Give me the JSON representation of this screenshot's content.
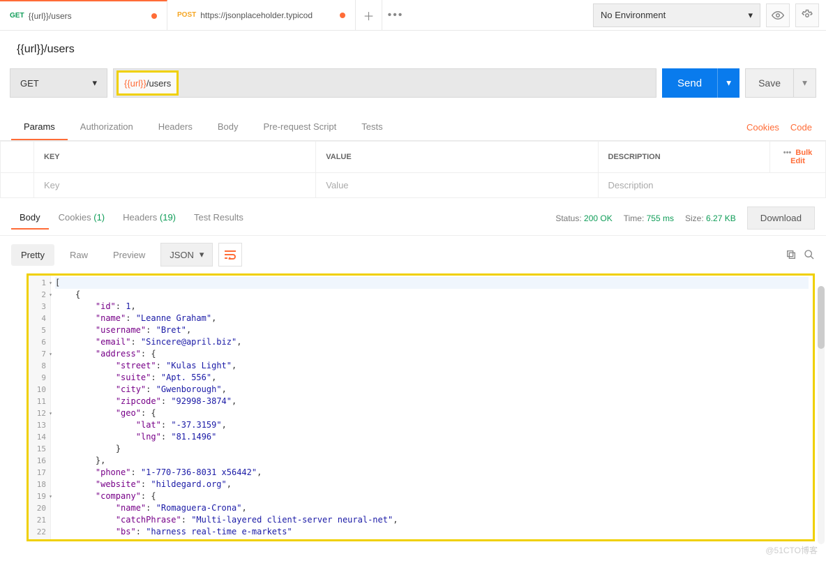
{
  "top": {
    "tabs": [
      {
        "method": "GET",
        "title": "{{url}}/users",
        "dirty": true
      },
      {
        "method": "POST",
        "title": "https://jsonplaceholder.typicod",
        "dirty": true
      }
    ],
    "environment": "No Environment"
  },
  "request": {
    "name": "{{url}}/users",
    "method": "GET",
    "url_var": "{{url}}",
    "url_path": "/users",
    "send": "Send",
    "save": "Save",
    "tabs": [
      "Params",
      "Authorization",
      "Headers",
      "Body",
      "Pre-request Script",
      "Tests"
    ],
    "cookies_link": "Cookies",
    "code_link": "Code",
    "params_header": {
      "key": "KEY",
      "value": "VALUE",
      "desc": "DESCRIPTION",
      "bulk": "Bulk Edit"
    },
    "params_placeholder": {
      "key": "Key",
      "value": "Value",
      "desc": "Description"
    }
  },
  "response": {
    "tabs": {
      "body": "Body",
      "cookies": "Cookies",
      "cookies_n": "(1)",
      "headers": "Headers",
      "headers_n": "(19)",
      "tests": "Test Results"
    },
    "status_label": "Status:",
    "status_val": "200 OK",
    "time_label": "Time:",
    "time_val": "755 ms",
    "size_label": "Size:",
    "size_val": "6.27 KB",
    "download": "Download",
    "views": {
      "pretty": "Pretty",
      "raw": "Raw",
      "preview": "Preview"
    },
    "format": "JSON",
    "code_lines": [
      "[",
      "    {",
      "        \"id\": 1,",
      "        \"name\": \"Leanne Graham\",",
      "        \"username\": \"Bret\",",
      "        \"email\": \"Sincere@april.biz\",",
      "        \"address\": {",
      "            \"street\": \"Kulas Light\",",
      "            \"suite\": \"Apt. 556\",",
      "            \"city\": \"Gwenborough\",",
      "            \"zipcode\": \"92998-3874\",",
      "            \"geo\": {",
      "                \"lat\": \"-37.3159\",",
      "                \"lng\": \"81.1496\"",
      "            }",
      "        },",
      "        \"phone\": \"1-770-736-8031 x56442\",",
      "        \"website\": \"hildegard.org\",",
      "        \"company\": {",
      "            \"name\": \"Romaguera-Crona\",",
      "            \"catchPhrase\": \"Multi-layered client-server neural-net\",",
      "            \"bs\": \"harness real-time e-markets\""
    ],
    "fold_lines": [
      1,
      2,
      7,
      12,
      19
    ]
  },
  "watermark": "@51CTO博客"
}
